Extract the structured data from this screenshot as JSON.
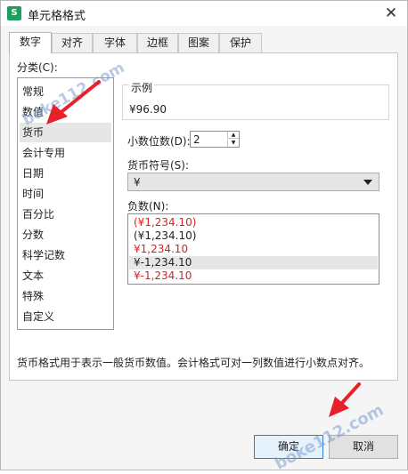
{
  "window": {
    "app_icon": "S",
    "title": "单元格格式",
    "close_glyph": "✕"
  },
  "tabs": [
    {
      "label": "数字"
    },
    {
      "label": "对齐"
    },
    {
      "label": "字体"
    },
    {
      "label": "边框"
    },
    {
      "label": "图案"
    },
    {
      "label": "保护"
    }
  ],
  "category": {
    "label": "分类(C):",
    "items": [
      {
        "label": "常规"
      },
      {
        "label": "数值"
      },
      {
        "label": "货币"
      },
      {
        "label": "会计专用"
      },
      {
        "label": "日期"
      },
      {
        "label": "时间"
      },
      {
        "label": "百分比"
      },
      {
        "label": "分数"
      },
      {
        "label": "科学记数"
      },
      {
        "label": "文本"
      },
      {
        "label": "特殊"
      },
      {
        "label": "自定义"
      }
    ],
    "selected_index": 2
  },
  "sample": {
    "label": "示例",
    "value": "¥96.90"
  },
  "decimal": {
    "label": "小数位数(D):",
    "value": "2",
    "up_glyph": "▲",
    "down_glyph": "▼"
  },
  "currency": {
    "label": "货币符号(S):",
    "value": "¥"
  },
  "negative": {
    "label": "负数(N):",
    "items": [
      {
        "label": "(¥1,234.10)",
        "color": "#e02020"
      },
      {
        "label": "(¥1,234.10)",
        "color": "#222222"
      },
      {
        "label": "¥1,234.10",
        "color": "#e02020"
      },
      {
        "label": "¥-1,234.10",
        "color": "#222222"
      },
      {
        "label": "¥-1,234.10",
        "color": "#e02020"
      }
    ],
    "selected_index": 3
  },
  "description": "货币格式用于表示一般货币数值。会计格式可对一列数值进行小数点对齐。",
  "buttons": {
    "ok": "确定",
    "cancel": "取消"
  },
  "watermarks": {
    "top": "boke112.com",
    "bottom": "boke112.com"
  },
  "colors": {
    "annotation_arrow": "#e8202a",
    "negative_red": "#e02020"
  }
}
